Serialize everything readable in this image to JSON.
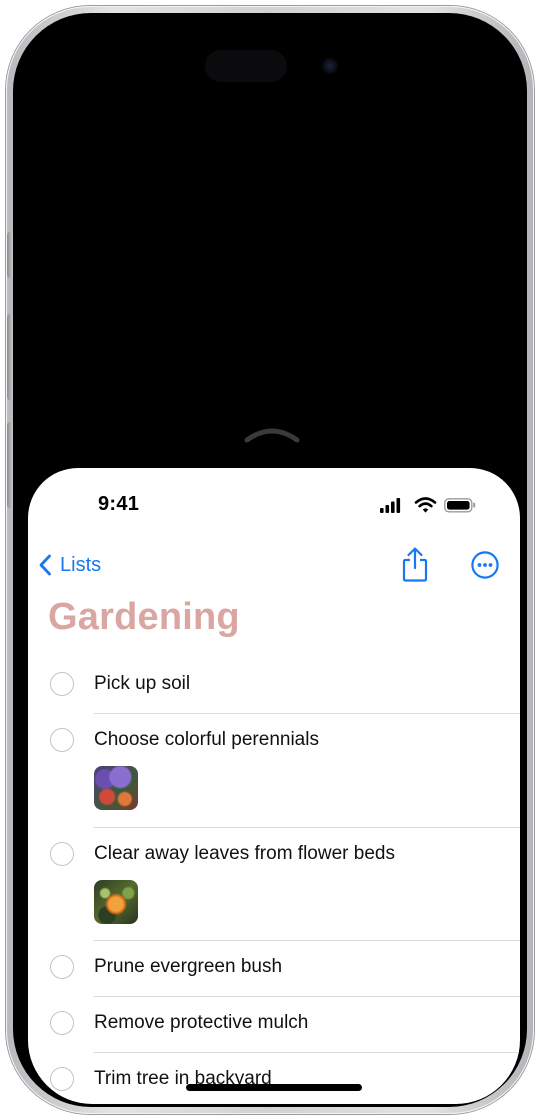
{
  "status_bar": {
    "time": "9:41"
  },
  "nav": {
    "back_label": "Lists"
  },
  "list": {
    "title": "Gardening",
    "title_color": "#d9a6a1",
    "items": [
      {
        "text": "Pick up soil",
        "has_image": false
      },
      {
        "text": "Choose colorful perennials",
        "has_image": true,
        "image": "perennials-photo"
      },
      {
        "text": "Clear away leaves from flower beds",
        "has_image": true,
        "image": "marigold-photo"
      },
      {
        "text": "Prune evergreen bush",
        "has_image": false
      },
      {
        "text": "Remove protective mulch",
        "has_image": false
      },
      {
        "text": "Trim tree in backyard",
        "has_image": false
      }
    ]
  },
  "colors": {
    "accent": "#1877f2",
    "checkbox_border": "#c4c4c8"
  },
  "icons": [
    "chevron-up-icon",
    "signal-icon",
    "wifi-icon",
    "battery-icon",
    "chevron-left-icon",
    "share-icon",
    "ellipsis-circle-icon"
  ]
}
